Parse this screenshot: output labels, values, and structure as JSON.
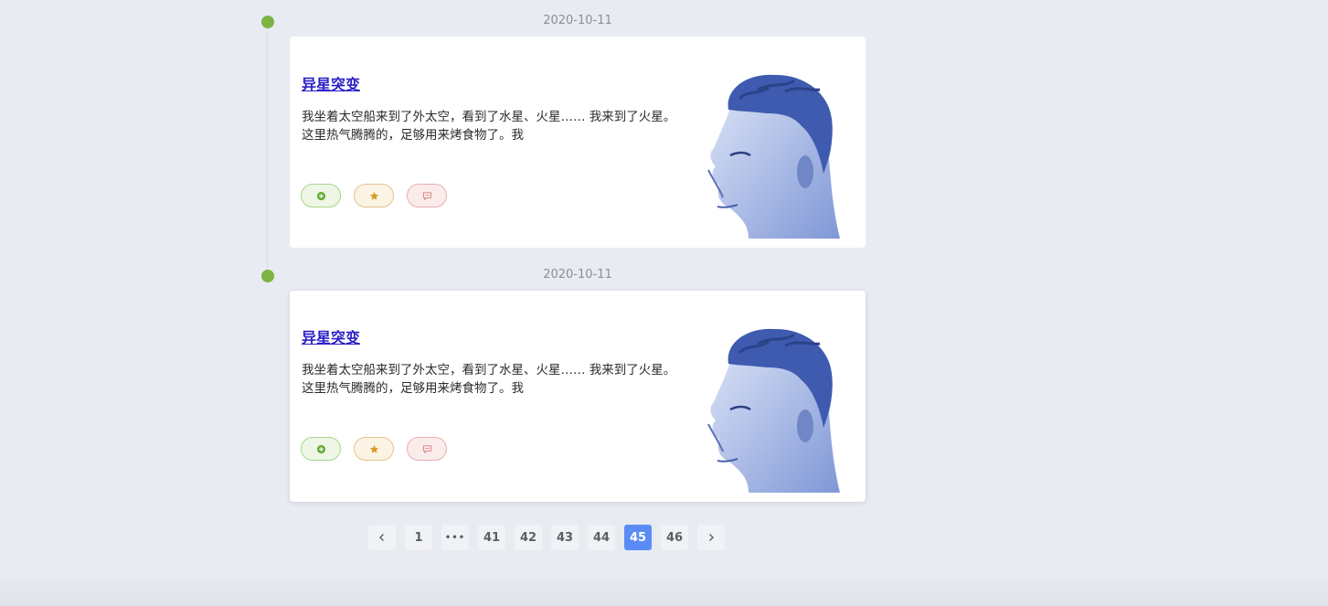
{
  "timeline": {
    "entries": [
      {
        "date": "2020-10-11",
        "title": "异星突变",
        "excerpt": "我坐着太空船来到了外太空，看到了水星、火星…… 我来到了火星。这里热气腾腾的，足够用来烤食物了。我"
      },
      {
        "date": "2020-10-11",
        "title": "异星突变",
        "excerpt": "我坐着太空船来到了外太空，看到了水星、火星…… 我来到了火星。这里热气腾腾的，足够用来烤食物了。我"
      }
    ]
  },
  "actions": {
    "like_icon": "plus-circle-icon",
    "star_icon": "star-icon",
    "comment_icon": "comment-icon"
  },
  "pagination": {
    "prev_icon": "chevron-left-icon",
    "next_icon": "chevron-right-icon",
    "first": "1",
    "ellipsis": "•••",
    "pages": [
      "41",
      "42",
      "43",
      "44",
      "45",
      "46"
    ],
    "current": "45"
  },
  "colors": {
    "accent": "#5b8cf5",
    "timeline_dot": "#7cb342",
    "title_link": "#2a1fc5"
  }
}
